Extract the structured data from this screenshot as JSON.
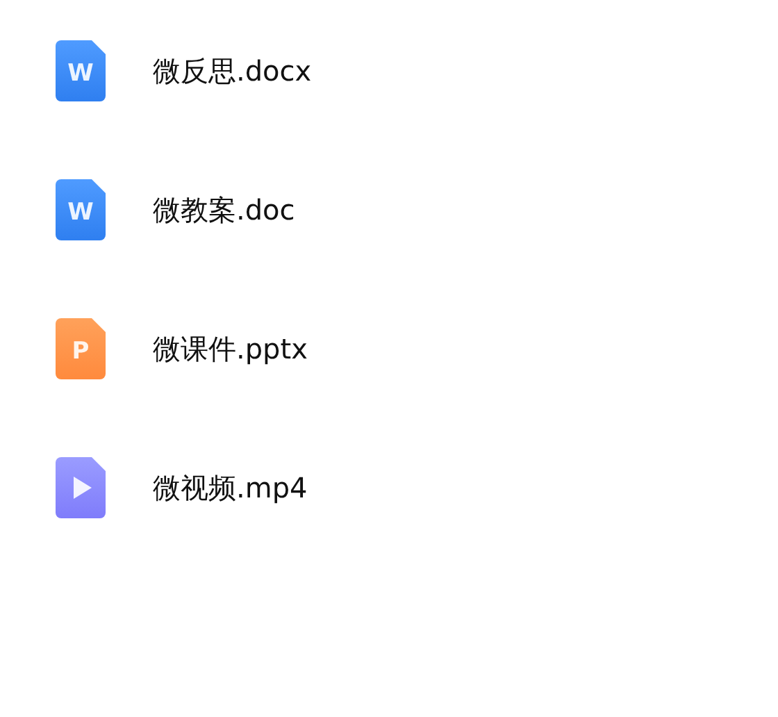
{
  "files": [
    {
      "name": "微反思.docx",
      "kind": "word",
      "letter": "W"
    },
    {
      "name": "微教案.doc",
      "kind": "word",
      "letter": "W"
    },
    {
      "name": "微课件.pptx",
      "kind": "ppt",
      "letter": "P"
    },
    {
      "name": "微视频.mp4",
      "kind": "video"
    }
  ]
}
